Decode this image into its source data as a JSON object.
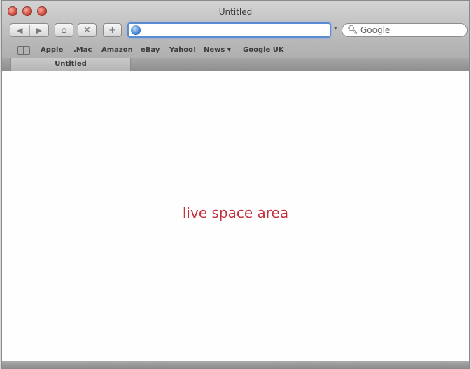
{
  "window": {
    "title": "Untitled"
  },
  "toolbar": {
    "back_icon": "back-arrow",
    "forward_icon": "forward-arrow",
    "home_icon": "home",
    "stop_icon": "stop",
    "add_icon": "add-bookmark",
    "url_value": "",
    "search_placeholder": "Google"
  },
  "bookmarks": {
    "items": [
      "Apple",
      ".Mac",
      "Amazon",
      "eBay",
      "Yahoo!",
      "News ▾",
      "Google UK"
    ]
  },
  "tabs": [
    {
      "label": "Untitled"
    }
  ],
  "content": {
    "text": "live space area",
    "text_color": "#c3313d"
  }
}
